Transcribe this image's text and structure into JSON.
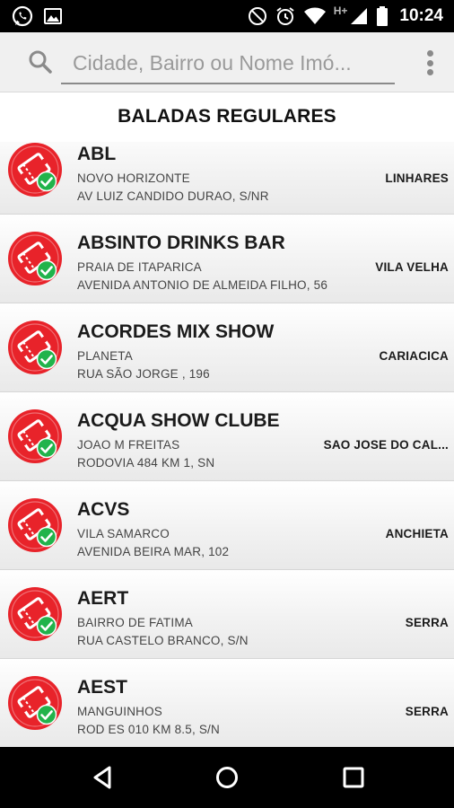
{
  "status_bar": {
    "time": "10:24",
    "network_label": "H+",
    "left_icons": [
      "whatsapp-icon",
      "gallery-icon"
    ],
    "right_icons": [
      "do-not-disturb-icon",
      "alarm-icon",
      "wifi-icon",
      "signal-icon",
      "battery-icon"
    ]
  },
  "search": {
    "placeholder": "Cidade, Bairro ou Nome Imó...",
    "value": ""
  },
  "section": {
    "title": "BALADAS REGULARES"
  },
  "colors": {
    "icon_red": "#e8232a",
    "check_green": "#21b34b",
    "status_bar": "#000000",
    "toolbar": "#f0f0f0"
  },
  "items": [
    {
      "name": "ABL",
      "bairro": "NOVO HORIZONTE",
      "endereco": "AV LUIZ CANDIDO DURAO, S/NR",
      "cidade": "LINHARES"
    },
    {
      "name": "ABSINTO DRINKS BAR",
      "bairro": "PRAIA DE ITAPARICA",
      "endereco": "AVENIDA ANTONIO DE ALMEIDA FILHO, 56",
      "cidade": "VILA VELHA"
    },
    {
      "name": "ACORDES MIX SHOW",
      "bairro": "PLANETA",
      "endereco": "RUA SÃO JORGE , 196",
      "cidade": "CARIACICA"
    },
    {
      "name": "ACQUA SHOW CLUBE",
      "bairro": "JOAO M FREITAS",
      "endereco": "RODOVIA 484 KM 1, SN",
      "cidade": "SAO JOSE DO CAL..."
    },
    {
      "name": "ACVS",
      "bairro": "VILA SAMARCO",
      "endereco": "AVENIDA BEIRA MAR, 102",
      "cidade": "ANCHIETA"
    },
    {
      "name": "AERT",
      "bairro": "BAIRRO DE FATIMA",
      "endereco": "RUA CASTELO BRANCO, S/N",
      "cidade": "SERRA"
    },
    {
      "name": "AEST",
      "bairro": "MANGUINHOS",
      "endereco": "ROD ES 010 KM 8.5, S/N",
      "cidade": "SERRA"
    }
  ],
  "nav": {
    "buttons": [
      "back-icon",
      "home-icon",
      "recents-icon"
    ]
  }
}
